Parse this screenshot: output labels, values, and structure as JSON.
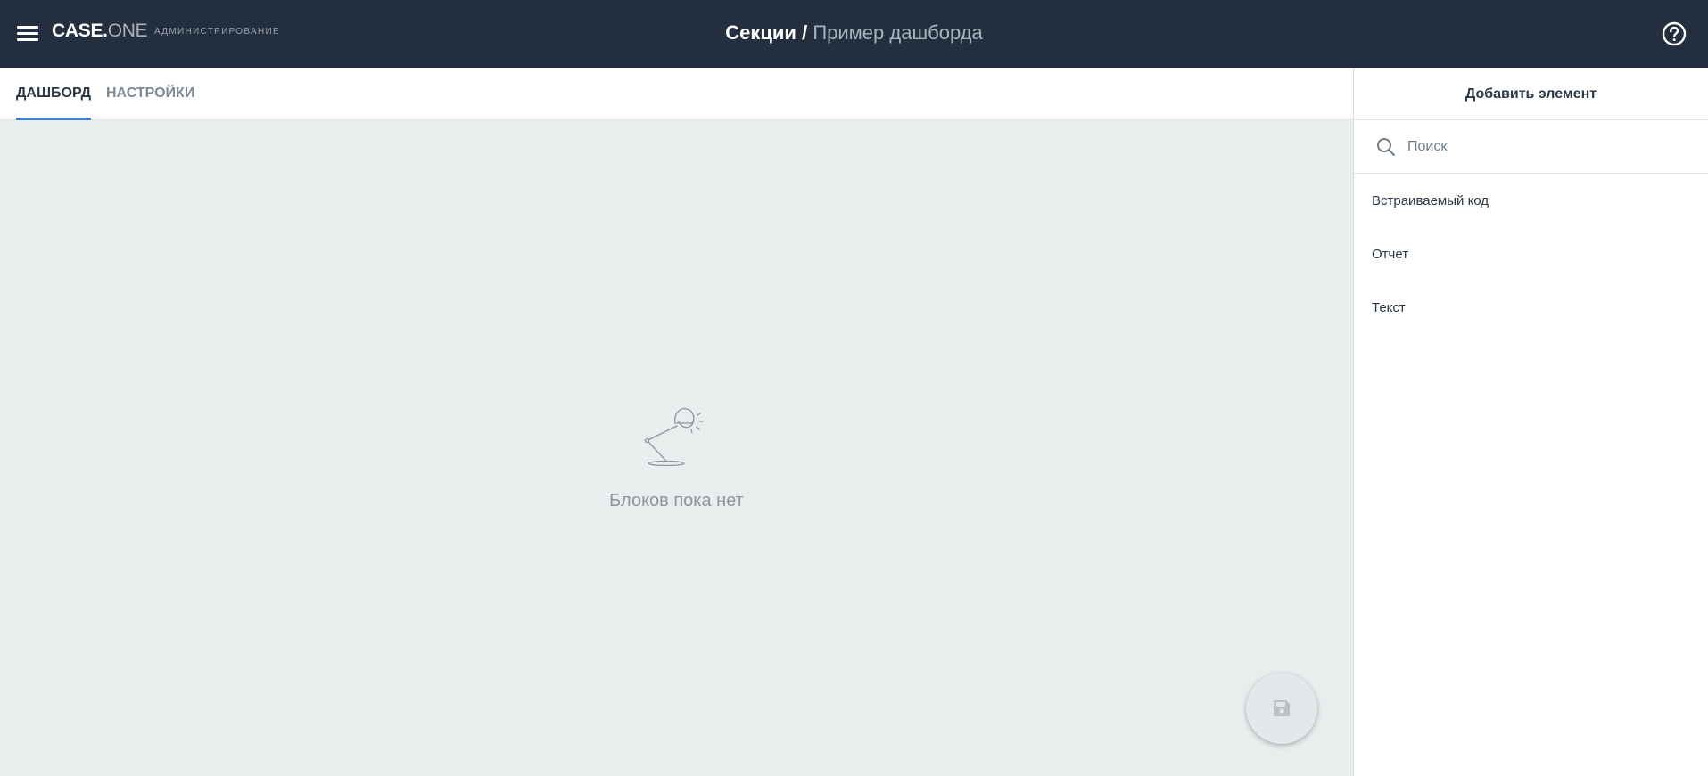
{
  "header": {
    "logo_main": "CASE.",
    "logo_accent": "ONE",
    "logo_sub": "АДМИНИСТРИРОВАНИЕ",
    "breadcrumb_parent": "Секции",
    "breadcrumb_separator": "/",
    "breadcrumb_current": "Пример дашборда",
    "menu_icon": "menu-icon",
    "help_icon": "help-circle-icon"
  },
  "tabs": [
    {
      "label": "ДАШБОРД",
      "active": true
    },
    {
      "label": "НАСТРОЙКИ",
      "active": false
    }
  ],
  "main": {
    "empty_icon": "desk-lamp-icon",
    "empty_text": "Блоков пока нет",
    "fab_icon": "save-icon"
  },
  "panel": {
    "title": "Добавить элемент",
    "search": {
      "placeholder": "Поиск",
      "value": "",
      "icon": "search-icon"
    },
    "items": [
      {
        "label": "Встраиваемый код"
      },
      {
        "label": "Отчет"
      },
      {
        "label": "Текст"
      }
    ]
  },
  "colors": {
    "header_bg": "#232f3e",
    "accent": "#3f7fd3",
    "canvas_bg": "#e9edee",
    "panel_bg": "#ffffff"
  }
}
